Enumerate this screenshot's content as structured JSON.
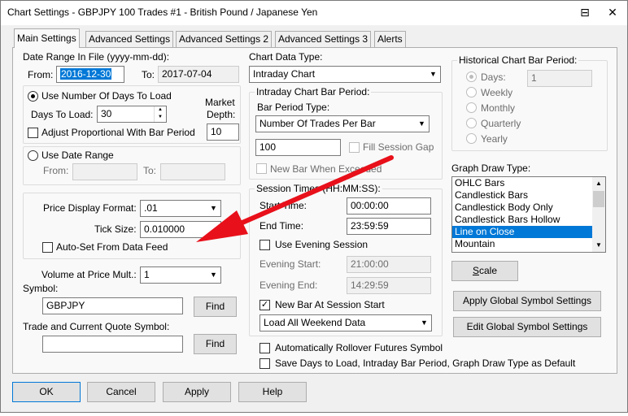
{
  "window": {
    "title": "Chart Settings - GBPJPY  100 Trades  #1 - British Pound / Japanese Yen",
    "btn_menu": "⊟",
    "btn_close": "✕"
  },
  "tabs": [
    {
      "label": "Main Settings"
    },
    {
      "label": "Advanced Settings"
    },
    {
      "label": "Advanced Settings 2"
    },
    {
      "label": "Advanced Settings 3"
    },
    {
      "label": "Alerts"
    }
  ],
  "date_range": {
    "label": "Date Range In File (yyyy-mm-dd):",
    "from_label": "From:",
    "from_value": "2016-12-30",
    "to_label": "To:",
    "to_value": "2017-07-04"
  },
  "days_group": {
    "use_days_label": "Use Number Of Days To Load",
    "days_to_load_label": "Days To Load:",
    "days_to_load_value": "30",
    "market_depth_label_1": "Market",
    "market_depth_label_2": "Depth:",
    "market_depth_value": "10",
    "adjust_label": "Adjust Proportional With Bar Period"
  },
  "date_range_group": {
    "use_date_range_label": "Use Date Range",
    "from_label": "From:",
    "to_label": "To:"
  },
  "price_group": {
    "price_format_label": "Price Display Format:",
    "price_format_value": ".01",
    "tick_size_label": "Tick Size:",
    "tick_size_value": "0.010000",
    "auto_set_label": "Auto-Set From Data Feed"
  },
  "volume": {
    "label": "Volume at Price Mult.:",
    "value": "1"
  },
  "symbol": {
    "label": "Symbol:",
    "value": "GBPJPY",
    "find": "Find",
    "trade_label": "Trade and Current Quote Symbol:",
    "trade_value": "",
    "find2": "Find"
  },
  "chart_data_type": {
    "label": "Chart Data Type:",
    "value": "Intraday Chart"
  },
  "intraday_group": {
    "title": "Intraday Chart Bar Period:",
    "bar_period_type_label": "Bar Period Type:",
    "bar_period_type_value": "Number Of Trades Per Bar",
    "bar_period_value": "100",
    "fill_gap_label": "Fill Session Gap",
    "new_bar_label": "New Bar When Exceeded"
  },
  "session_group": {
    "title": "Session Times (HH:MM:SS):",
    "start_label": "Start Time:",
    "start_value": "00:00:00",
    "end_label": "End Time:",
    "end_value": "23:59:59",
    "use_evening_label": "Use Evening Session",
    "evening_start_label": "Evening Start:",
    "evening_start_value": "21:00:00",
    "evening_end_label": "Evening End:",
    "evening_end_value": "14:29:59",
    "new_bar_session_label": "New Bar At Session Start",
    "weekend_value": "Load All Weekend Data"
  },
  "rollover_label": "Automatically Rollover Futures Symbol",
  "save_default_label": "Save Days to Load, Intraday Bar Period, Graph Draw Type as Default",
  "historical_group": {
    "title": "Historical Chart Bar Period:",
    "days_label": "Days:",
    "days_value": "1",
    "weekly": "Weekly",
    "monthly": "Monthly",
    "quarterly": "Quarterly",
    "yearly": "Yearly"
  },
  "graph_draw": {
    "label": "Graph Draw Type:",
    "items": [
      "OHLC Bars",
      "Candlestick Bars",
      "Candlestick Body Only",
      "Candlestick Bars Hollow",
      "Line on Close",
      "Mountain"
    ]
  },
  "buttons": {
    "scale": "Scale",
    "apply_global": "Apply Global Symbol Settings",
    "edit_global": "Edit Global Symbol Settings",
    "ok": "OK",
    "cancel": "Cancel",
    "apply": "Apply",
    "help": "Help"
  },
  "colors": {
    "arrow": "#e8101a",
    "selection": "#0078d7"
  }
}
